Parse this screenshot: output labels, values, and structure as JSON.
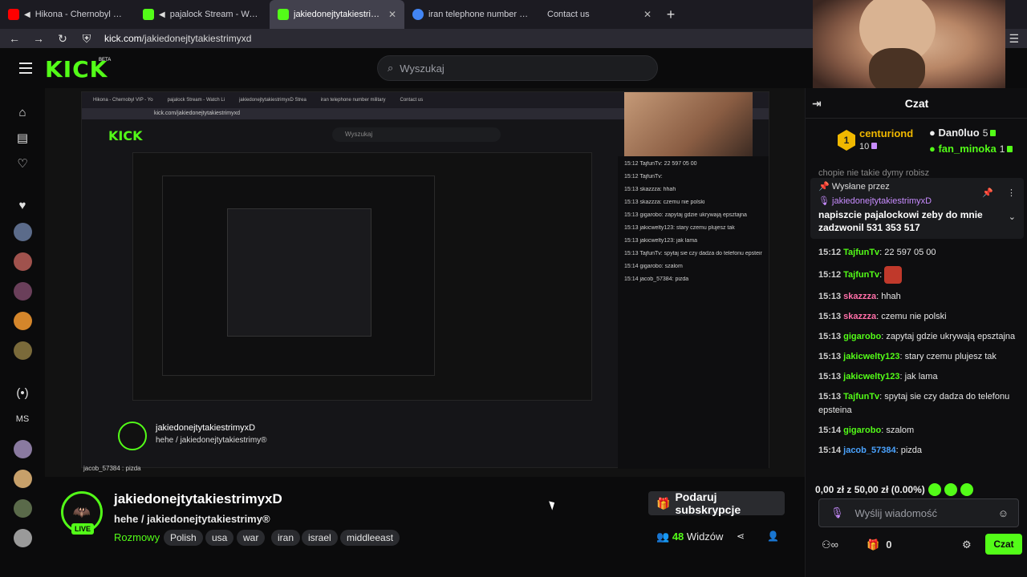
{
  "browser": {
    "tabs": [
      {
        "title": "Hikona - Chernobyl VIP - Yo",
        "favicon_color": "#ff0000",
        "audio": true
      },
      {
        "title": "pajalock Stream - Watch Li",
        "favicon_color": "#53fc18",
        "audio": true
      },
      {
        "title": "jakiedonejtytakiestrimyxD Strea",
        "favicon_color": "#53fc18",
        "audio": false,
        "active": true
      },
      {
        "title": "iran telephone number military",
        "favicon_color": "#4285f4",
        "audio": false
      },
      {
        "title": "Contact us",
        "favicon_color": "",
        "audio": false
      }
    ],
    "url_host": "kick.com",
    "url_path": "/jakiedonejtytakiestrimyxd"
  },
  "header": {
    "logo": "KICK",
    "logo_badge": "BETA",
    "search_placeholder": "Wyszukaj"
  },
  "sidebar": {
    "channel_labels": [
      "MS"
    ]
  },
  "video": {
    "nested_tabs": [
      "Hikona - Chernobyl VIP - Yo",
      "pajalock Stream - Watch Li",
      "jakiedonejtytakiestrimyxD Strea",
      "iran telephone number military",
      "Contact us"
    ],
    "nested_url": "kick.com/jakiedonejtytakiestrimyxd",
    "nested_logo": "KICK",
    "nested_search": "Wyszukaj",
    "nested_chat": [
      "15:12 TajfunTv: 22 597 05 00",
      "15:12 TajfunTv:",
      "15:13 skazzza: hhah",
      "15:13 skazzza: czemu nie polski",
      "15:13 gigarobo: zapytaj gdzie ukrywają epsztajna",
      "15:13 jakicwelty123: stary czemu plujesz tak",
      "15:13 jakicwelty123: jak lama",
      "15:13 TajfunTv: spytaj sie czy dadza do telefonu epsteina",
      "15:14 gigarobo: szalom",
      "15:14 jacob_57384: pizda"
    ],
    "nested_channel": "jakiedonejtytakiestrimyxD",
    "nested_sub": "hehe / jakiedonejtytakiestrimy®",
    "nested_pizda": "jacob_57384 : pizda"
  },
  "chat": {
    "title": "Czat",
    "leaderboard": {
      "first": {
        "rank": "1",
        "name": "centuriond",
        "count": "10"
      },
      "second": {
        "name": "Dan0luo",
        "count": "5"
      },
      "third": {
        "name": "fan_minoka",
        "count": "1"
      }
    },
    "pinned": {
      "label": "Wysłane przez",
      "user": "jakiedonejtytakiestrimyxD",
      "message": "napiszcie pajalockowi zeby do mnie zadzwonil 531 353 517"
    },
    "prev_line": "chopie nie takie dymy robisz",
    "messages": [
      {
        "time": "15:12",
        "user": "TajfunTv",
        "color": "#53fc18",
        "text": "22 597 05 00"
      },
      {
        "time": "15:12",
        "user": "TajfunTv",
        "color": "#53fc18",
        "text": "",
        "emote": true
      },
      {
        "time": "15:13",
        "user": "skazzza",
        "color": "#ff6fa8",
        "text": "hhah"
      },
      {
        "time": "15:13",
        "user": "skazzza",
        "color": "#ff6fa8",
        "text": "czemu nie polski"
      },
      {
        "time": "15:13",
        "user": "gigarobo",
        "color": "#53fc18",
        "text": "zapytaj gdzie ukrywają epsztajna"
      },
      {
        "time": "15:13",
        "user": "jakicwelty123",
        "color": "#53fc18",
        "text": "stary czemu plujesz tak"
      },
      {
        "time": "15:13",
        "user": "jakicwelty123",
        "color": "#53fc18",
        "text": "jak lama"
      },
      {
        "time": "15:13",
        "user": "TajfunTv",
        "color": "#53fc18",
        "text": "spytaj sie czy dadza do telefonu epsteina"
      },
      {
        "time": "15:14",
        "user": "gigarobo",
        "color": "#53fc18",
        "text": "szalom"
      },
      {
        "time": "15:14",
        "user": "jacob_57384",
        "color": "#4aa3ff",
        "text": "pizda"
      }
    ],
    "gift_goal": "0,00 zł z 50,00 zł (0.00%)",
    "input_placeholder": "Wyślij wiadomość",
    "footer_count": "0",
    "send_label": "Czat"
  },
  "stream": {
    "channel_name": "jakiedonejtytakiestrimyxD",
    "subtitle": "hehe / jakiedonejtytakiestrimy®",
    "live_label": "LIVE",
    "category": "Rozmowy",
    "tags": [
      "Polish",
      "usa",
      "war",
      "iran",
      "israel",
      "middleeast"
    ],
    "sub_button": "Podaruj subskrypcje",
    "viewer_count": "48",
    "viewer_label": "Widzów"
  },
  "colors": {
    "accent": "#53fc18",
    "background": "#0b0b0c"
  }
}
